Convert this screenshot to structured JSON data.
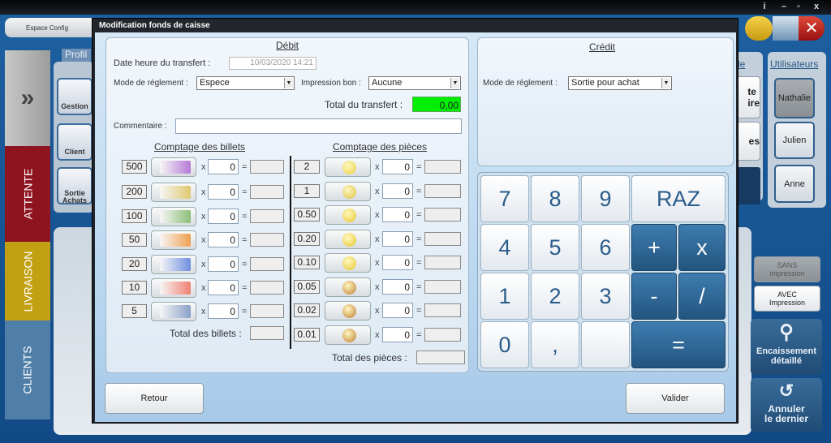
{
  "window_controls": {
    "info": "i",
    "minimize": "–",
    "restore": "▫",
    "close": "x"
  },
  "app": {
    "espace": "Espace Config",
    "profil": "Profil",
    "tools": [
      {
        "label": "Gestion"
      },
      {
        "label": "Client"
      },
      {
        "label": "Sortie Achats"
      }
    ],
    "tabs": {
      "attente": "ATTENTE",
      "livraison": "LIVRAISON",
      "clients": "CLIENTS"
    },
    "right": {
      "mode_label": "de",
      "partial_1": "te\nire",
      "partial_2": "es",
      "users_title": "Utilisateurs",
      "users": [
        "Nathalie",
        "Julien",
        "Anne"
      ],
      "sans": "SANS\nimpression",
      "avec": "AVEC\nImpression",
      "encaissement": "Encaissement\ndétaillé",
      "annuler": "Annuler\nle dernier"
    }
  },
  "dialog": {
    "title": "Modification fonds de caisse",
    "debit": {
      "title": "Débit",
      "date_label": "Date heure du transfert :",
      "date_value": "10/03/2020 14:21",
      "mode_label": "Mode de réglement :",
      "mode_value": "Espece",
      "impression_label": "Impression bon :",
      "impression_value": "Aucune",
      "total_label": "Total du transfert :",
      "total_value": "0,00",
      "total_color": "#00ee00",
      "comment_label": "Commentaire :",
      "comment_value": "",
      "bills_title": "Comptage des billets",
      "coins_title": "Comptage des pièces",
      "bills": [
        {
          "denom": "500",
          "qty": "0",
          "color": "#b57ad6"
        },
        {
          "denom": "200",
          "qty": "0",
          "color": "#e0c870"
        },
        {
          "denom": "100",
          "qty": "0",
          "color": "#8cbf7a"
        },
        {
          "denom": "50",
          "qty": "0",
          "color": "#f0a050"
        },
        {
          "denom": "20",
          "qty": "0",
          "color": "#6f8fe0"
        },
        {
          "denom": "10",
          "qty": "0",
          "color": "#f08070"
        },
        {
          "denom": "5",
          "qty": "0",
          "color": "#8aa0c8"
        }
      ],
      "coins": [
        {
          "denom": "2",
          "qty": "0",
          "color": "#e8d040"
        },
        {
          "denom": "1",
          "qty": "0",
          "color": "#d8c040"
        },
        {
          "denom": "0.50",
          "qty": "0",
          "color": "#e6c628"
        },
        {
          "denom": "0.20",
          "qty": "0",
          "color": "#e6c628"
        },
        {
          "denom": "0.10",
          "qty": "0",
          "color": "#e6c628"
        },
        {
          "denom": "0.05",
          "qty": "0",
          "color": "#c07a30"
        },
        {
          "denom": "0.02",
          "qty": "0",
          "color": "#c07a30"
        },
        {
          "denom": "0.01",
          "qty": "0",
          "color": "#c07a30"
        }
      ],
      "times": "x",
      "equals": "=",
      "bills_total_label": "Total des billets :",
      "coins_total_label": "Total des pièces :"
    },
    "credit": {
      "title": "Crédit",
      "mode_label": "Mode de réglement :",
      "mode_value": "Sortie pour achat"
    },
    "keypad": [
      "7",
      "8",
      "9",
      "RAZ",
      "4",
      "5",
      "6",
      "+",
      "x",
      "1",
      "2",
      "3",
      "-",
      "/",
      "0",
      ",",
      "",
      "="
    ],
    "retour": "Retour",
    "valider": "Valider"
  }
}
